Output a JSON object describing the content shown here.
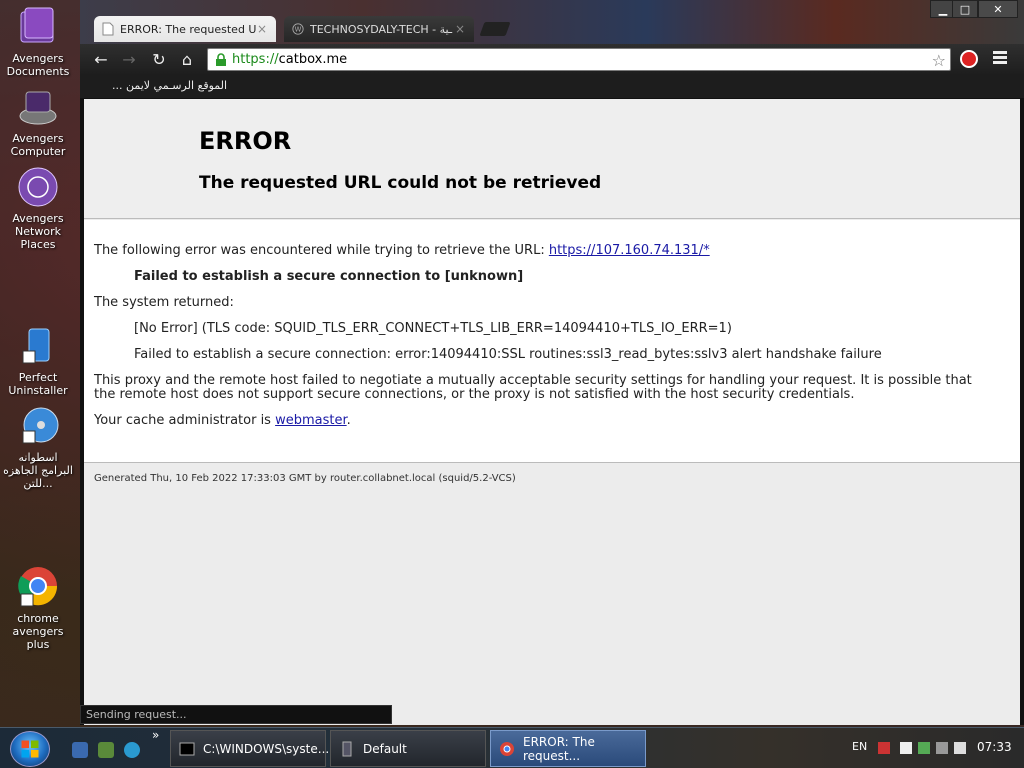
{
  "desktop": {
    "icons": [
      {
        "label": "Avengers Documents"
      },
      {
        "label": "Avengers Computer"
      },
      {
        "label": "Avengers Network Places"
      },
      {
        "label": "Perfect Uninstaller"
      },
      {
        "label": "اسطوانه البرامج الجاهزه للتن..."
      },
      {
        "label": "chrome avengers plus"
      }
    ]
  },
  "browser": {
    "tabs": [
      {
        "title": "ERROR: The requested URL",
        "close": "×"
      },
      {
        "title": "TECHNOSYDALY-TECH - ـية",
        "close": "×"
      }
    ],
    "window_controls": {
      "minimize": "▁",
      "maximize": "□",
      "close": "✕"
    },
    "address": {
      "scheme": "https://",
      "host": "catbox.me"
    },
    "bookmarks": [
      "الموقع الرسـمي لايمن ..."
    ],
    "status": "Sending request..."
  },
  "page": {
    "title": "ERROR",
    "subtitle": "The requested URL could not be retrieved",
    "intro": "The following error was encountered while trying to retrieve the URL: ",
    "intro_link": "https://107.160.74.131/*",
    "error_message": "Failed to establish a secure connection to [unknown]",
    "system_returned": "The system returned:",
    "detail_1": "[No Error] (TLS code: SQUID_TLS_ERR_CONNECT+TLS_LIB_ERR=14094410+TLS_IO_ERR=1)",
    "detail_2": "Failed to establish a secure connection: error:14094410:SSL routines:ssl3_read_bytes:sslv3 alert handshake failure",
    "explanation": "This proxy and the remote host failed to negotiate a mutually acceptable security settings for handling your request. It is possible that the remote host does not support secure connections, or the proxy is not satisfied with the host security credentials.",
    "admin_prefix": "Your cache administrator is ",
    "admin_link": "webmaster",
    "admin_suffix": ".",
    "footer": "Generated Thu, 10 Feb 2022 17:33:03 GMT by router.collabnet.local (squid/5.2-VCS)"
  },
  "taskbar": {
    "tasks": [
      {
        "label": "C:\\WINDOWS\\syste..."
      },
      {
        "label": "Default"
      },
      {
        "label": "ERROR: The request..."
      }
    ],
    "overflow": "»",
    "language": "EN",
    "clock": "07:33"
  },
  "colors": {
    "accent_link": "#1a1aa6",
    "secure_green": "#1a8a1a",
    "page_header_bg": "#eeeeee"
  }
}
